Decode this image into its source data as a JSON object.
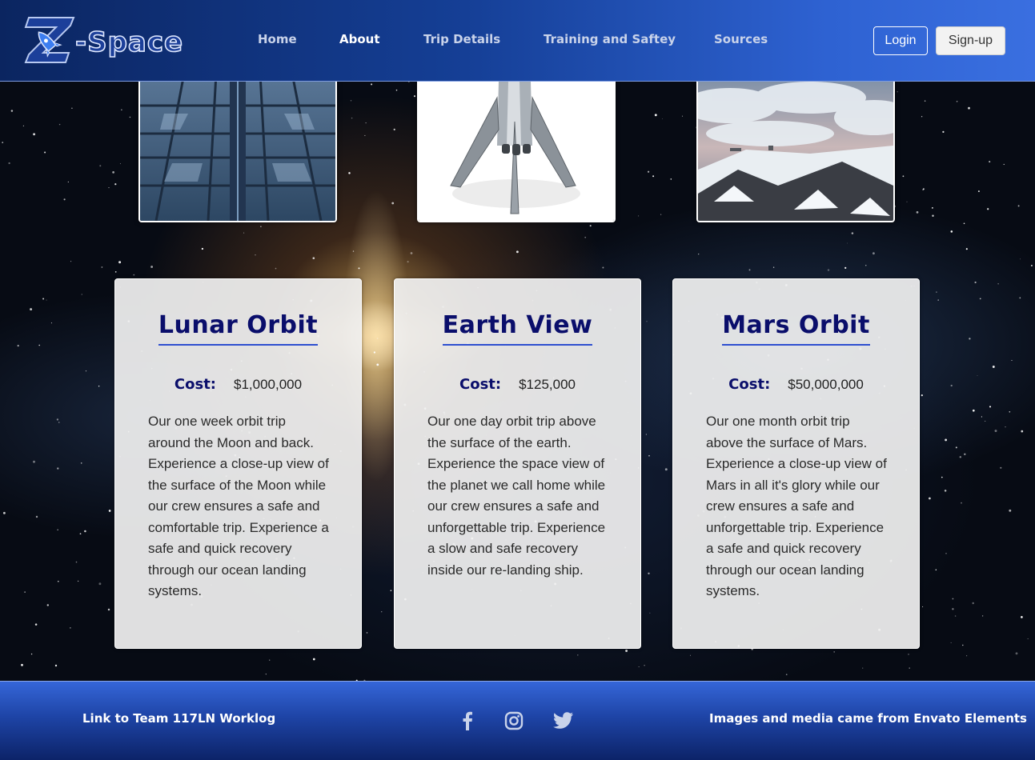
{
  "header": {
    "logo_text": "Z-Space",
    "nav": [
      {
        "label": "Home",
        "active": false
      },
      {
        "label": "About",
        "active": true
      },
      {
        "label": "Trip Details",
        "active": false
      },
      {
        "label": "Training and Saftey",
        "active": false
      },
      {
        "label": "Sources",
        "active": false
      }
    ],
    "login_label": "Login",
    "signup_label": "Sign-up"
  },
  "gallery": [
    {
      "icon": "space-corridor-image"
    },
    {
      "icon": "rocket-image"
    },
    {
      "icon": "mountain-landscape-image"
    }
  ],
  "cards": [
    {
      "title": "Lunar Orbit",
      "cost_label": "Cost:",
      "cost_value": "$1,000,000",
      "description": "Our one week orbit trip around the Moon and back. Experience a close-up view of the surface of the Moon while our crew ensures a safe and comfortable trip. Experience a safe and quick recovery through our ocean landing systems."
    },
    {
      "title": "Earth View",
      "cost_label": "Cost:",
      "cost_value": "$125,000",
      "description": "Our one day orbit trip above the surface of the earth. Experience the space view of the planet we call home while our crew ensures a safe and unforgettable trip. Experience a slow and safe recovery inside our re-landing ship."
    },
    {
      "title": "Mars Orbit",
      "cost_label": "Cost:",
      "cost_value": "$50,000,000",
      "description": "Our one month orbit trip above the surface of Mars. Experience a close-up view of Mars in all it's glory while our crew ensures a safe and unforgettable trip. Experience a safe and quick recovery through our ocean landing systems."
    }
  ],
  "footer": {
    "worklog_link": "Link to Team 117LN Worklog",
    "credits": "Images and media came from Envato Elements",
    "social": [
      "facebook-icon",
      "instagram-icon",
      "twitter-icon"
    ]
  },
  "colors": {
    "card_title": "#0a0e6b",
    "title_underline": "#2e4fd0",
    "header_gradient_start": "#0b2560",
    "header_gradient_end": "#3a6fe0"
  }
}
